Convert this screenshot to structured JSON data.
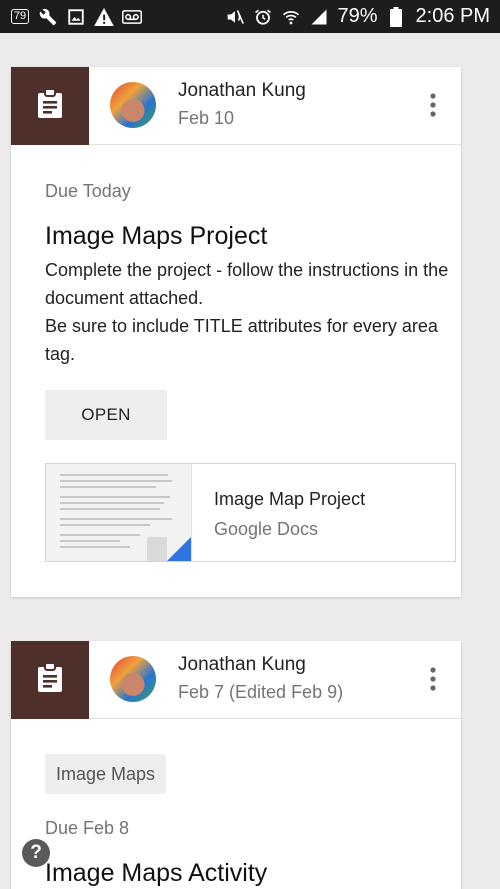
{
  "status_bar": {
    "badge_count": "79",
    "battery_percent": "79%",
    "time": "2:06 PM",
    "icons": [
      "notification-badge-icon",
      "wrench-icon",
      "image-icon",
      "warning-icon",
      "voicemail-icon",
      "mute-icon",
      "alarm-icon",
      "wifi-icon",
      "signal-icon",
      "battery-icon"
    ]
  },
  "posts": [
    {
      "type_icon": "assignment-icon",
      "author": "Jonathan Kung",
      "date": "Feb 10",
      "due": "Due Today",
      "title": "Image Maps Project",
      "description": "Complete the project - follow the instructions in the document attached.\nBe sure to include TITLE attributes for every area tag.",
      "open_label": "OPEN",
      "attachment": {
        "title": "Image Map Project",
        "source": "Google Docs"
      }
    },
    {
      "type_icon": "assignment-icon",
      "author": "Jonathan Kung",
      "date": "Feb 7 (Edited Feb 9)",
      "topic": "Image Maps",
      "due": "Due Feb 8",
      "title": "Image Maps Activity"
    }
  ],
  "colors": {
    "accent_brown": "#4f2f2a",
    "background": "#eceaea",
    "doc_blue": "#2f74e0"
  }
}
